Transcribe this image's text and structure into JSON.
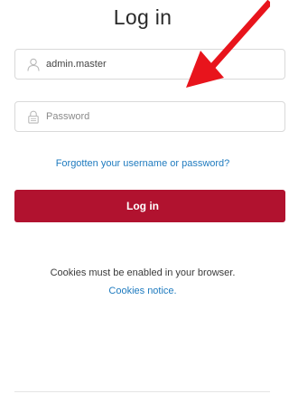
{
  "page": {
    "title": "Log in"
  },
  "form": {
    "username": {
      "value": "admin.master",
      "icon": "user-icon"
    },
    "password": {
      "placeholder": "Password",
      "icon": "lock-icon"
    },
    "forgot_link": "Forgotten your username or password?",
    "submit_label": "Log in",
    "accent_color": "#b1122f"
  },
  "cookies": {
    "message": "Cookies must be enabled in your browser.",
    "notice_link": "Cookies notice."
  },
  "annotation": {
    "arrow_color": "#e8141c",
    "arrow_icon": "red-arrow-annotation"
  }
}
